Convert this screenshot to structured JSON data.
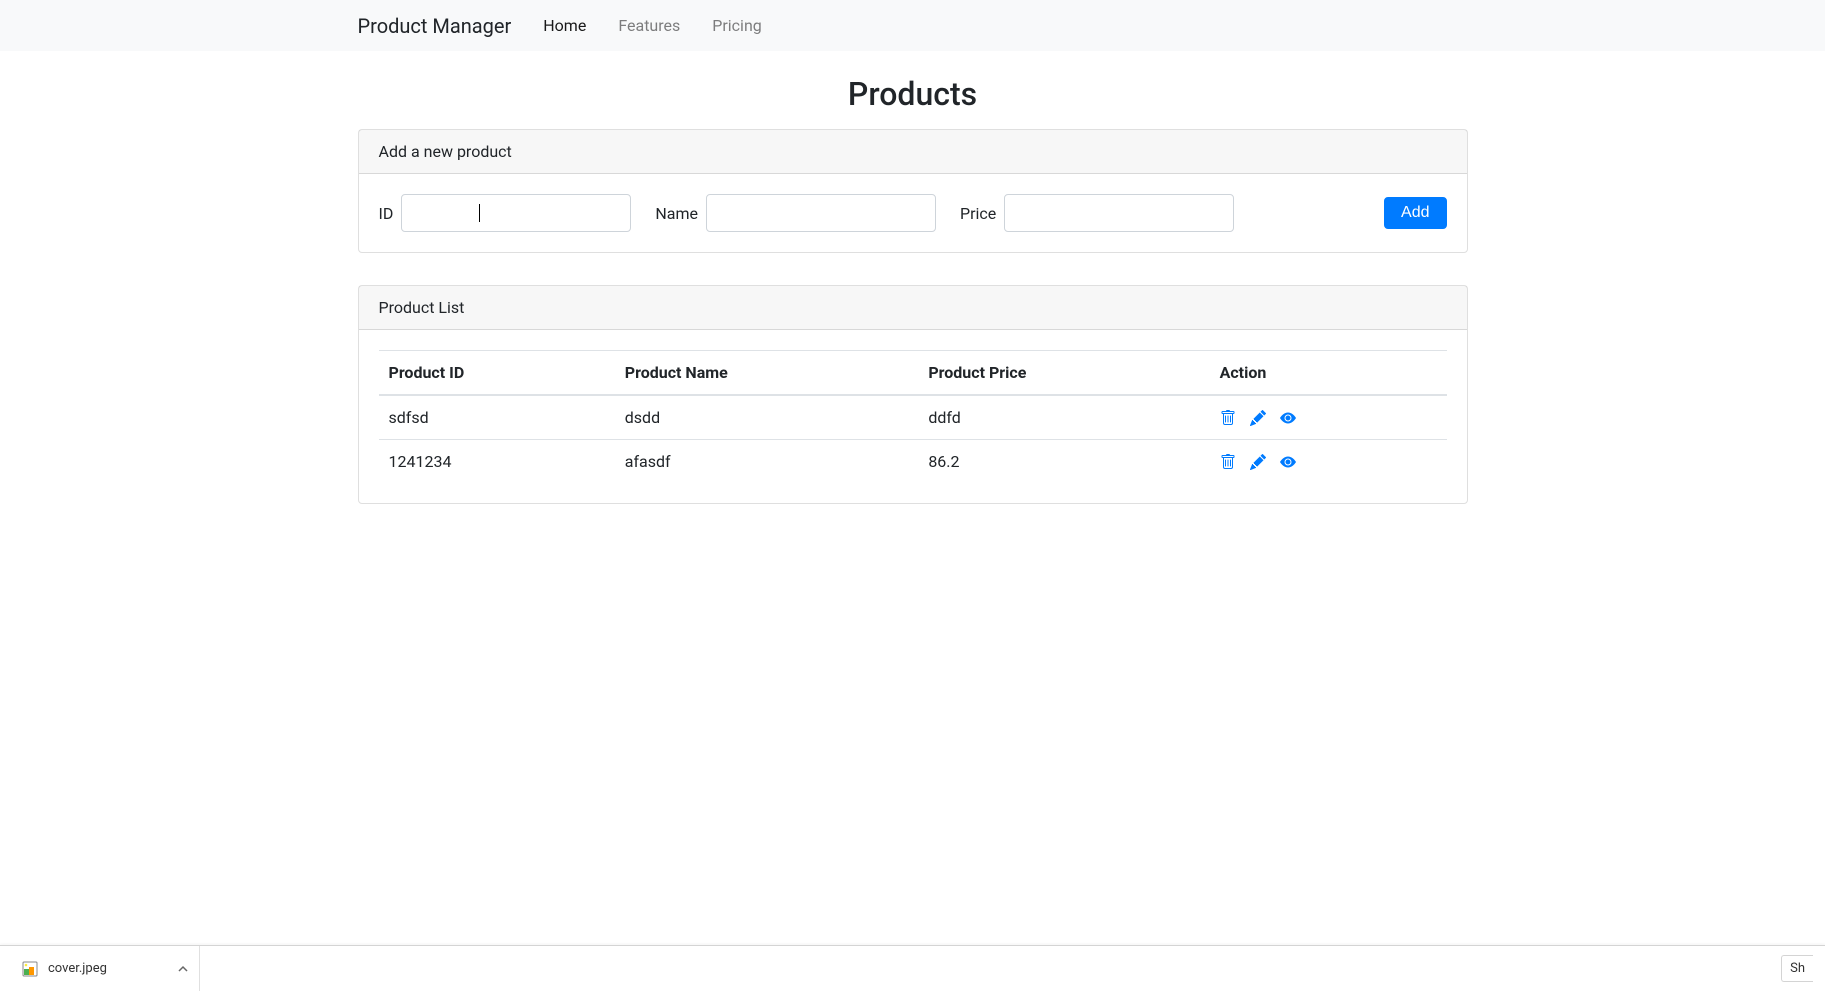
{
  "navbar": {
    "brand": "Product Manager",
    "links": [
      {
        "label": "Home",
        "active": true
      },
      {
        "label": "Features",
        "active": false
      },
      {
        "label": "Pricing",
        "active": false
      }
    ]
  },
  "page": {
    "title": "Products"
  },
  "add_form": {
    "card_title": "Add a new product",
    "id_label": "ID",
    "id_value": "",
    "name_label": "Name",
    "name_value": "",
    "price_label": "Price",
    "price_value": "",
    "add_button": "Add"
  },
  "product_list": {
    "card_title": "Product List",
    "headers": {
      "id": "Product ID",
      "name": "Product Name",
      "price": "Product Price",
      "action": "Action"
    },
    "rows": [
      {
        "id": "sdfsd",
        "name": "dsdd",
        "price": "ddfd"
      },
      {
        "id": "1241234",
        "name": "afasdf",
        "price": "86.2"
      }
    ]
  },
  "downloads": {
    "file_name": "cover.jpeg",
    "show_all": "Sh"
  }
}
